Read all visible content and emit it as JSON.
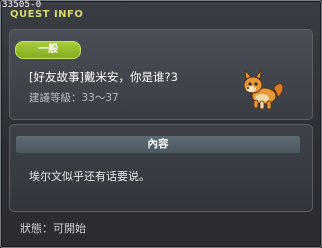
{
  "window": {
    "quest_id": "33505-0",
    "title": "QUEST INFO"
  },
  "quest": {
    "category_badge": "一般",
    "name": "[好友故事]戴米安，你是谁?3",
    "level_range": "建議等級：33～37",
    "npc_icon": "fox-npc-icon"
  },
  "content": {
    "header": "內容",
    "text": "埃尔文似乎还有话要说。"
  },
  "status": "狀態：可開始",
  "colors": {
    "title": "#d6d96a",
    "badge": "#94bd2a"
  }
}
